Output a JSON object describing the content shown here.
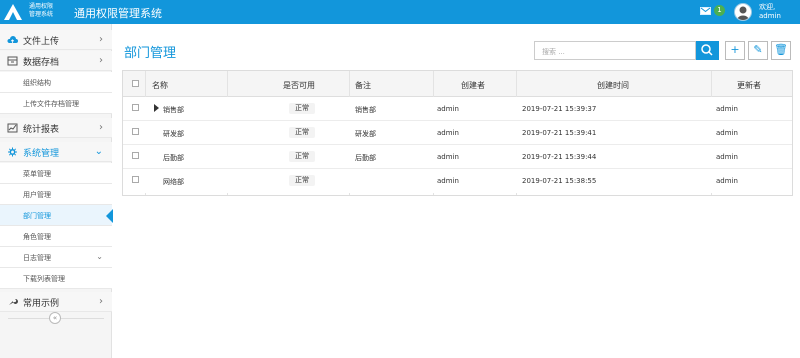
{
  "header": {
    "logo_title_line1": "通用权限",
    "logo_title_line2": "管理系统",
    "app_title": "通用权限管理系统",
    "mail_badge": "1",
    "welcome": "欢迎,",
    "username": "admin"
  },
  "sidebar": {
    "items": [
      {
        "label": "文件上传",
        "icon": "cloud-upload-icon"
      },
      {
        "label": "数据存档",
        "icon": "archive-icon"
      },
      {
        "label": "组织结构"
      },
      {
        "label": "上传文件存档管理"
      },
      {
        "label": "统计报表",
        "icon": "chart-icon"
      },
      {
        "label": "系统管理",
        "icon": "gear-icon"
      },
      {
        "label": "菜单管理"
      },
      {
        "label": "用户管理"
      },
      {
        "label": "部门管理"
      },
      {
        "label": "角色管理"
      },
      {
        "label": "日志管理"
      },
      {
        "label": "下载列表管理"
      },
      {
        "label": "常用示例",
        "icon": "wrench-icon"
      }
    ],
    "collapse_label": "«"
  },
  "main": {
    "title": "部门管理",
    "search_placeholder": "搜索 ...",
    "actions": {
      "add": "+",
      "edit": "✎",
      "delete": "🗑"
    }
  },
  "table": {
    "columns": [
      "名称",
      "是否可用",
      "备注",
      "创建者",
      "创建时间",
      "更新者"
    ],
    "rows": [
      {
        "name": "销售部",
        "status": "正常",
        "remark": "销售部",
        "creator": "admin",
        "created_at": "2019-07-21 15:39:37",
        "updater": "admin"
      },
      {
        "name": "研发部",
        "status": "正常",
        "remark": "研发部",
        "creator": "admin",
        "created_at": "2019-07-21 15:39:41",
        "updater": "admin"
      },
      {
        "name": "后勤部",
        "status": "正常",
        "remark": "后勤部",
        "creator": "admin",
        "created_at": "2019-07-21 15:39:44",
        "updater": "admin"
      },
      {
        "name": "网络部",
        "status": "正常",
        "remark": "",
        "creator": "admin",
        "created_at": "2019-07-21 15:38:55",
        "updater": "admin"
      }
    ]
  },
  "colors": {
    "primary": "#1296db",
    "sidebar_bg": "#f5f5f5",
    "text": "#333333",
    "badge": "#4caf50"
  }
}
